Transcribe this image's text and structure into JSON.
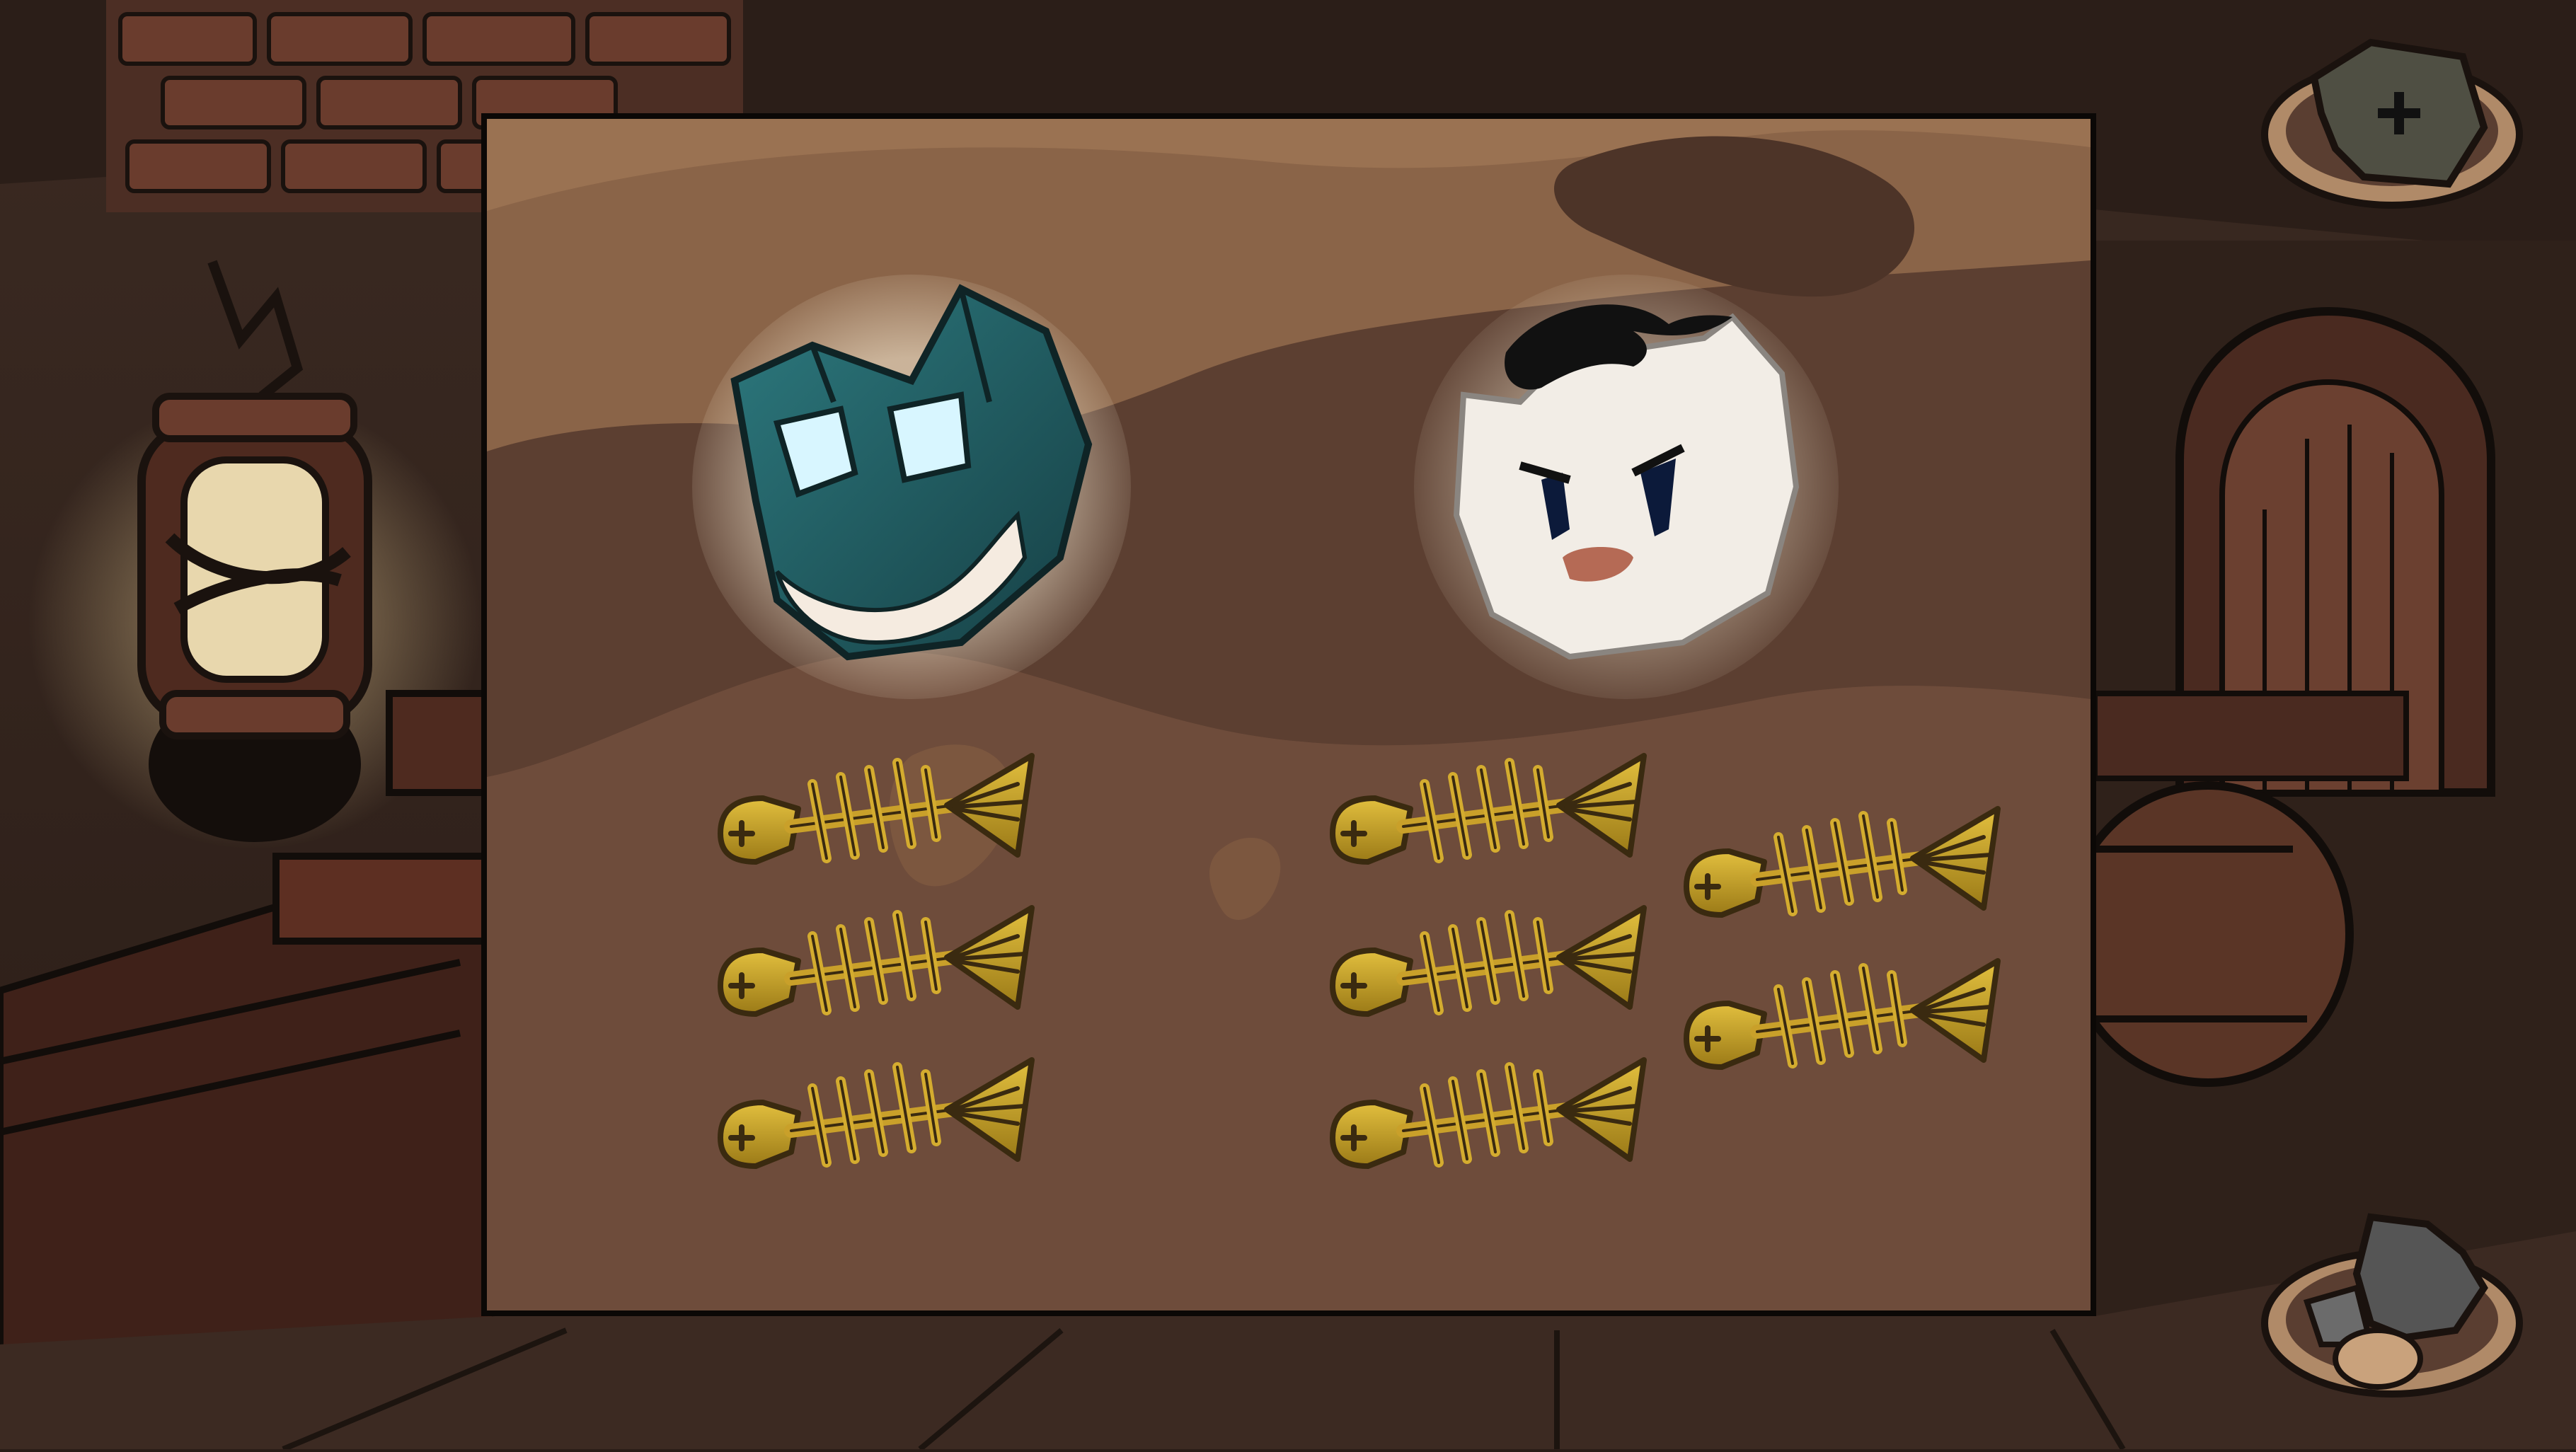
{
  "screen": {
    "name": "mask-choice",
    "colors": {
      "panel_bg": "#6b4a3a",
      "panel_swirl_light": "#8a6448",
      "panel_swirl_dark": "#5a3e31",
      "fish_gold": "#c9a02a",
      "fish_outline": "#3a2a10",
      "bat_mask": "#1f5a5e",
      "bat_eyes": "#d8f6ff",
      "pompadour_mask": "#f2ede6",
      "pompadour_hair": "#111111"
    }
  },
  "options": [
    {
      "id": "bat-mask",
      "icon": "bat-cat-mask-icon",
      "fish_cost_icon": "fish-skeleton-icon",
      "fish_count": 3
    },
    {
      "id": "pompadour-mask",
      "icon": "pompadour-cat-mask-icon",
      "fish_cost_icon": "fish-skeleton-icon",
      "fish_count": 5
    }
  ],
  "hud": {
    "top_right": {
      "icon": "broken-mask-plate-icon"
    },
    "bottom_right": {
      "icon": "rock-plate-icon"
    }
  }
}
